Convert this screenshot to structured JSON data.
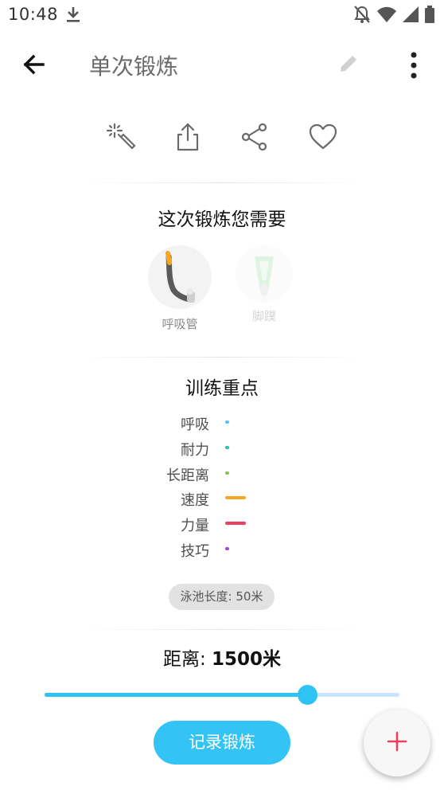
{
  "status_bar": {
    "time": "10:48"
  },
  "app_bar": {
    "title": "单次锻炼"
  },
  "equipment": {
    "heading": "这次锻炼您需要",
    "items": [
      {
        "label": "呼吸管",
        "active": true
      },
      {
        "label": "脚蹼",
        "active": false
      }
    ]
  },
  "training_focus": {
    "heading": "训练重点",
    "items": [
      {
        "label": "呼吸",
        "color": "#4fc3f7",
        "level": 0.1
      },
      {
        "label": "耐力",
        "color": "#26c6a6",
        "level": 0.1
      },
      {
        "label": "长距离",
        "color": "#8bc34a",
        "level": 0.1
      },
      {
        "label": "速度",
        "color": "#f5a623",
        "level": 1.0
      },
      {
        "label": "力量",
        "color": "#ee3e62",
        "level": 1.0
      },
      {
        "label": "技巧",
        "color": "#9c4dcc",
        "level": 0.1
      }
    ]
  },
  "pool_chip": "泳池长度: 50米",
  "distance": {
    "label": "距离:",
    "value": "1500米",
    "slider_fraction": 0.74
  },
  "record_button": "记录锻炼",
  "colors": {
    "accent": "#2fc3f4",
    "slider_track": "#c8e4ff",
    "fab_plus": "#ee3e62"
  },
  "icons": [
    "download-icon",
    "dnd-off-icon",
    "wifi-icon",
    "signal-icon",
    "battery-icon",
    "back-arrow-icon",
    "edit-pencil-icon",
    "more-vert-icon",
    "magic-wand-icon",
    "export-icon",
    "share-icon",
    "heart-icon",
    "snorkel-icon",
    "fins-icon",
    "plus-icon"
  ]
}
